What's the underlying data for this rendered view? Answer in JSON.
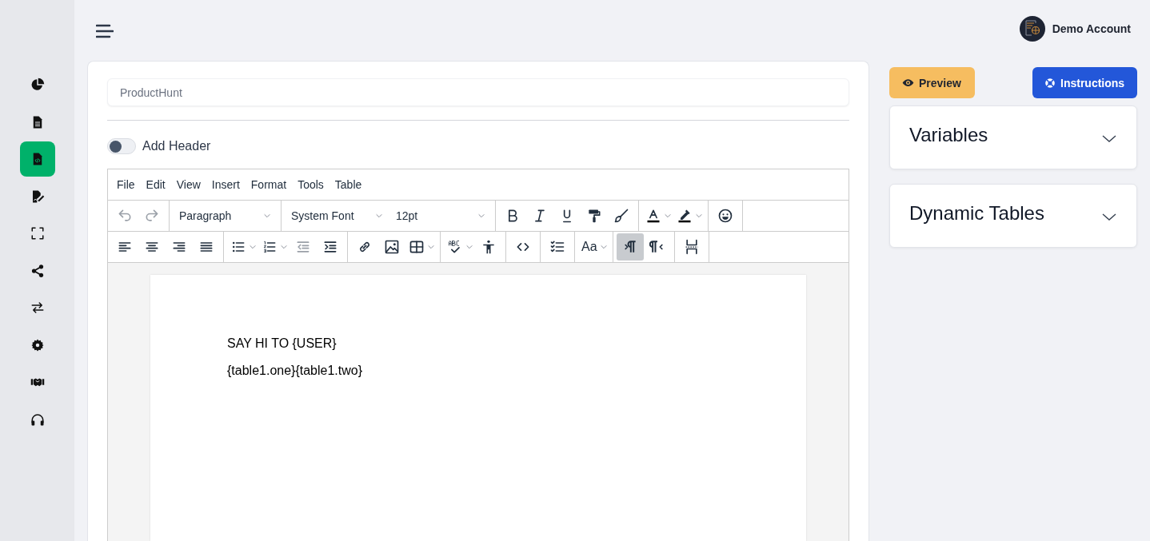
{
  "sidebar": {
    "items": [
      {
        "selected": false
      },
      {
        "selected": false
      },
      {
        "selected": true
      },
      {
        "selected": false
      },
      {
        "selected": false
      },
      {
        "selected": false
      },
      {
        "selected": false
      },
      {
        "selected": false
      },
      {
        "selected": false
      },
      {
        "selected": false
      }
    ]
  },
  "account": {
    "name": "Demo Account"
  },
  "document": {
    "title_field": {
      "value": "ProductHunt"
    },
    "add_header": {
      "label": "Add Header",
      "on": false
    },
    "editor": {
      "menu": [
        "File",
        "Edit",
        "View",
        "Insert",
        "Format",
        "Tools",
        "Table"
      ],
      "toolbar_rows": [
        [
          [
            {
              "kind": "icon",
              "disabled": true
            },
            {
              "kind": "icon",
              "disabled": true
            }
          ],
          [
            {
              "kind": "select",
              "label": "Paragraph"
            }
          ],
          [
            {
              "kind": "select",
              "label": "System Font"
            },
            {
              "kind": "select",
              "label": "12pt"
            }
          ],
          [
            {
              "kind": "icon"
            },
            {
              "kind": "icon"
            },
            {
              "kind": "icon"
            },
            {
              "kind": "icon"
            },
            {
              "kind": "icon"
            }
          ],
          [
            {
              "kind": "split"
            },
            {
              "kind": "split"
            }
          ],
          [
            {
              "kind": "icon"
            }
          ]
        ],
        [
          [
            {
              "kind": "icon"
            },
            {
              "kind": "icon"
            },
            {
              "kind": "icon"
            },
            {
              "kind": "icon"
            }
          ],
          [
            {
              "kind": "split"
            },
            {
              "kind": "split"
            },
            {
              "kind": "icon",
              "disabled": true
            },
            {
              "kind": "icon"
            }
          ],
          [
            {
              "kind": "icon"
            },
            {
              "kind": "icon"
            },
            {
              "kind": "split"
            }
          ],
          [
            {
              "kind": "split"
            },
            {
              "kind": "icon"
            }
          ],
          [
            {
              "kind": "icon"
            }
          ],
          [
            {
              "kind": "icon"
            }
          ],
          [
            {
              "kind": "split",
              "label": "Aa"
            }
          ],
          [
            {
              "kind": "icon",
              "active": true
            },
            {
              "kind": "icon",
              "active": false
            }
          ],
          [
            {
              "kind": "icon"
            }
          ]
        ]
      ],
      "content": [
        "SAY HI TO {USER}",
        "{table1.one}{table1.two}"
      ]
    }
  },
  "actions": {
    "preview": "Preview",
    "instructions": "Instructions"
  },
  "panels": [
    {
      "title": "Variables",
      "expanded": false
    },
    {
      "title": "Dynamic Tables",
      "expanded": false
    }
  ]
}
